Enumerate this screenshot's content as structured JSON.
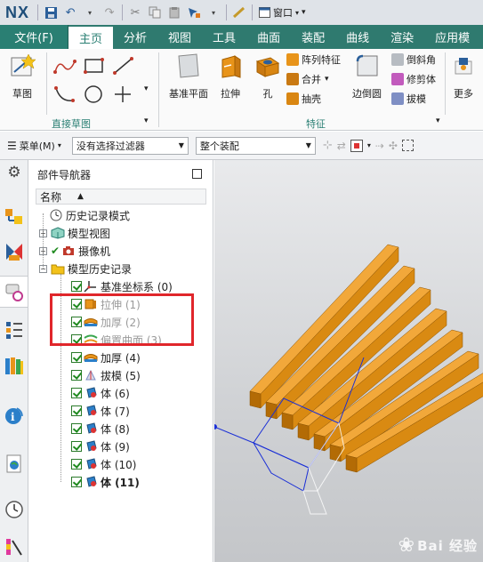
{
  "app": {
    "logo": "NX"
  },
  "quick_access": {
    "window_menu": "窗口"
  },
  "tabs": [
    "文件(F)",
    "主页",
    "分析",
    "视图",
    "工具",
    "曲面",
    "装配",
    "曲线",
    "渲染",
    "应用模"
  ],
  "ribbon": {
    "sketch_label": "草图",
    "group_direct_sketch": "直接草图",
    "datum_plane": "基准平面",
    "extrude": "拉伸",
    "hole": "孔",
    "pattern_feature": "阵列特征",
    "unite": "合并",
    "shell": "抽壳",
    "edge_blend": "边倒圆",
    "chamfer": "倒斜角",
    "trim_body": "修剪体",
    "draft": "拔模",
    "more": "更多",
    "group_feature": "特征"
  },
  "toolbar2": {
    "menu": "菜单(M)",
    "filter": "没有选择过滤器",
    "scope": "整个装配"
  },
  "navigator": {
    "title": "部件导航器",
    "column_name": "名称",
    "items": [
      {
        "label": "历史记录模式",
        "dim": false,
        "bold": false
      },
      {
        "label": "模型视图",
        "dim": false,
        "bold": false
      },
      {
        "label": "摄像机",
        "dim": false,
        "bold": false
      },
      {
        "label": "模型历史记录",
        "dim": false,
        "bold": false
      },
      {
        "label": "基准坐标系 (0)",
        "dim": false,
        "bold": false
      },
      {
        "label": "拉伸 (1)",
        "dim": true,
        "bold": false
      },
      {
        "label": "加厚 (2)",
        "dim": true,
        "bold": false
      },
      {
        "label": "偏置曲面 (3)",
        "dim": true,
        "bold": false
      },
      {
        "label": "加厚 (4)",
        "dim": false,
        "bold": false
      },
      {
        "label": "拔模 (5)",
        "dim": false,
        "bold": false
      },
      {
        "label": "体 (6)",
        "dim": false,
        "bold": false
      },
      {
        "label": "体 (7)",
        "dim": false,
        "bold": false
      },
      {
        "label": "体 (8)",
        "dim": false,
        "bold": false
      },
      {
        "label": "体 (9)",
        "dim": false,
        "bold": false
      },
      {
        "label": "体 (10)",
        "dim": false,
        "bold": false
      },
      {
        "label": "体 (11)",
        "dim": false,
        "bold": true
      }
    ]
  },
  "colors": {
    "tab_bar": "#2f7a6f",
    "highlight_box": "#e0262b",
    "solid_orange": "#d98a12"
  }
}
